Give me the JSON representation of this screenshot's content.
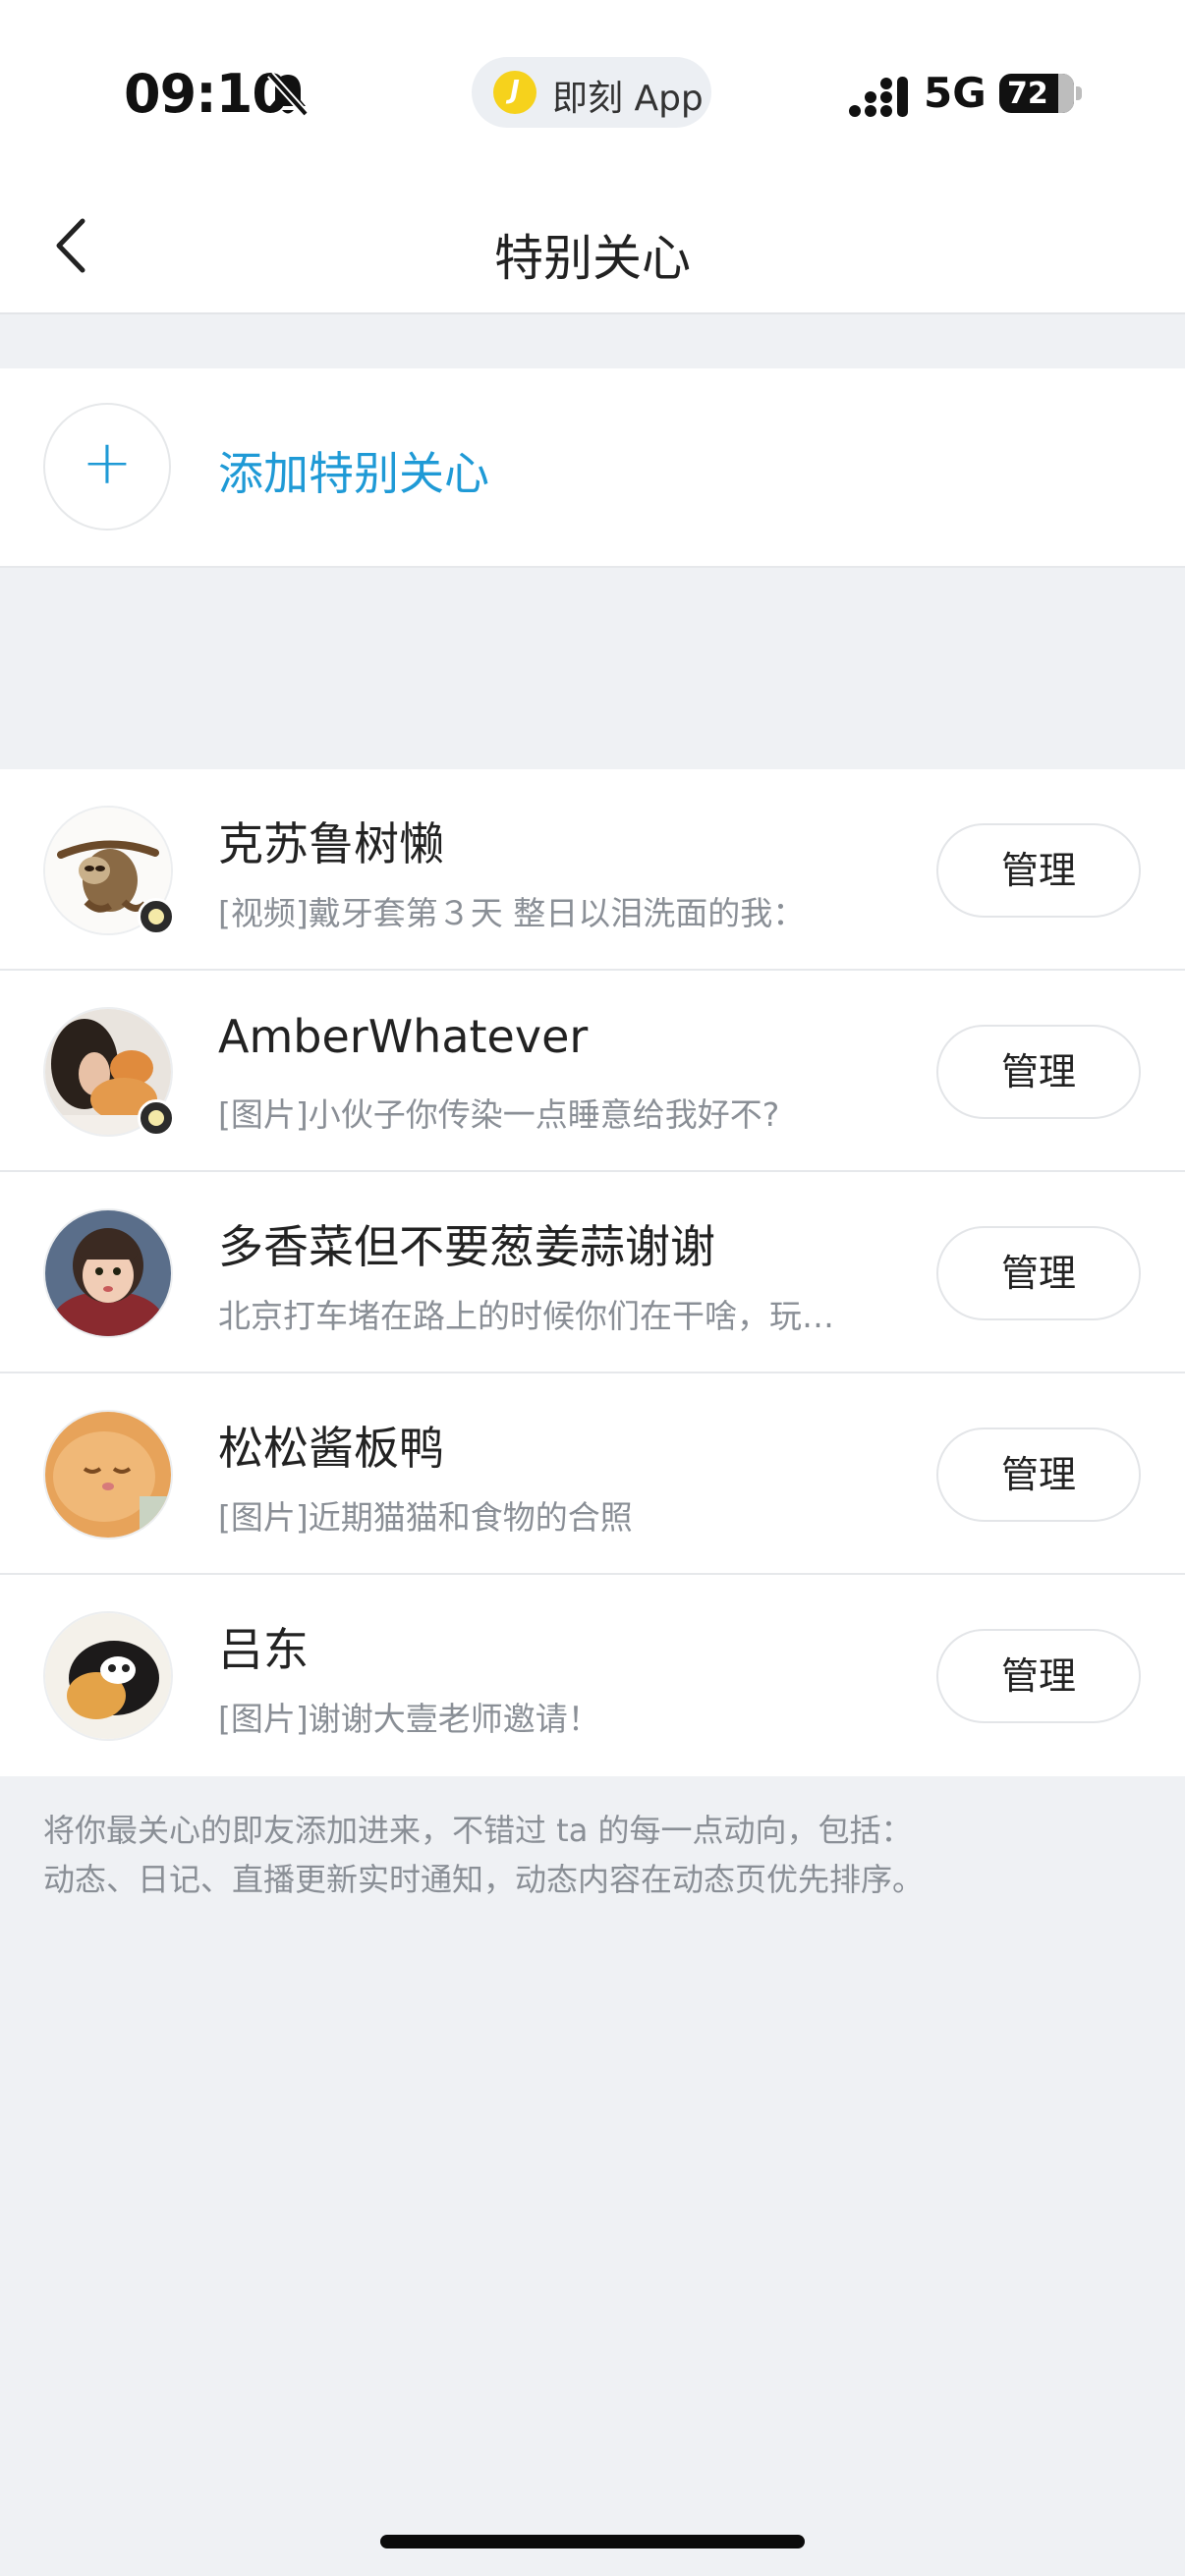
{
  "status_bar": {
    "time": "09:10",
    "app_pill_label": "即刻 App",
    "network": "5G",
    "battery": "72"
  },
  "nav": {
    "title": "特别关心"
  },
  "add_row": {
    "label": "添加特别关心"
  },
  "list": [
    {
      "name": "克苏鲁树懒",
      "desc": "[视频]戴牙套第３天 整日以泪洗面的我：",
      "manage": "管理"
    },
    {
      "name": "AmberWhatever",
      "desc": "[图片]小伙子你传染一点睡意给我好不?",
      "manage": "管理"
    },
    {
      "name": "多香菜但不要葱姜蒜谢谢",
      "desc": "北京打车堵在路上的时候你们在干啥，玩…",
      "manage": "管理"
    },
    {
      "name": "松松酱板鸭",
      "desc": "[图片]近期猫猫和食物的合照",
      "manage": "管理"
    },
    {
      "name": "吕东",
      "desc": "[图片]谢谢大壹老师邀请！",
      "manage": "管理"
    }
  ],
  "footer": {
    "line1": "将你最关心的即友添加进来，不错过 ta 的每一点动向，包括：",
    "line2": "动态、日记、直播更新实时通知，动态内容在动态页优先排序。"
  },
  "colors": {
    "accent": "#1f9ad6",
    "page_bg": "#eff1f4",
    "secondary_text": "#8a8f96"
  }
}
